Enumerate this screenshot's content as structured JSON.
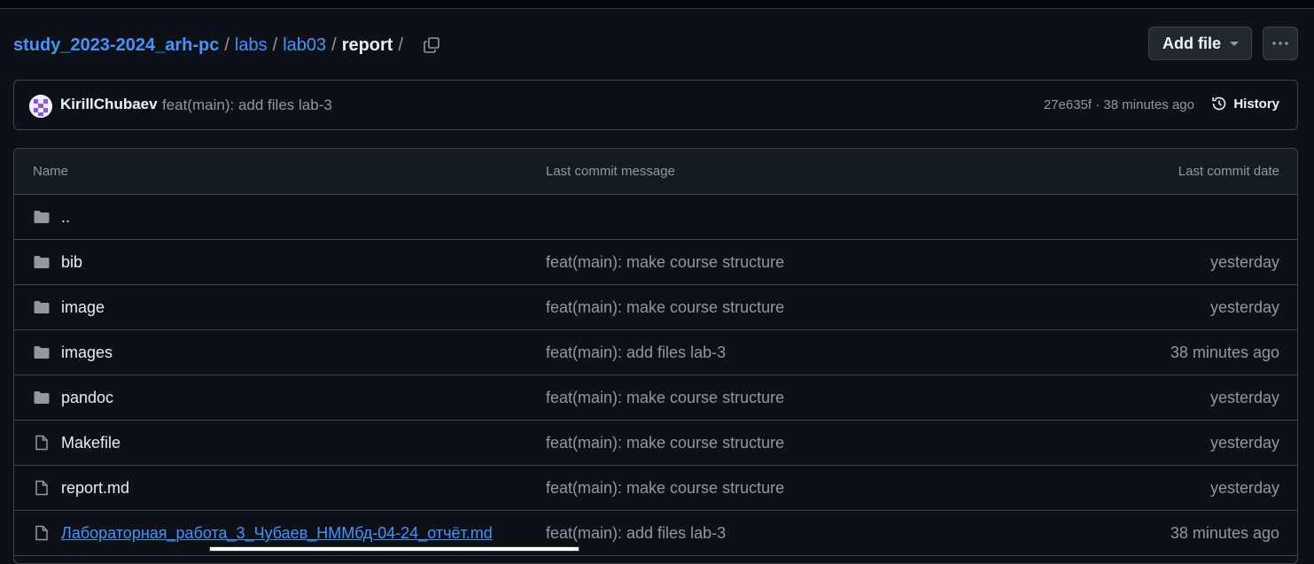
{
  "breadcrumb": {
    "repo": "study_2023-2024_arh-pc",
    "parts": [
      "labs",
      "lab03"
    ],
    "current": "report",
    "separator": "/"
  },
  "actions": {
    "add_file": "Add file"
  },
  "commit": {
    "author": "KirillChubaev",
    "message": "feat(main): add files lab-3",
    "hash_time": "27e635f · 38 minutes ago",
    "history_label": "History"
  },
  "table": {
    "headers": {
      "name": "Name",
      "message": "Last commit message",
      "date": "Last commit date"
    },
    "parent": "..",
    "rows": [
      {
        "name": "bib",
        "type": "folder",
        "message": "feat(main): make course structure",
        "date": "yesterday"
      },
      {
        "name": "image",
        "type": "folder",
        "message": "feat(main): make course structure",
        "date": "yesterday"
      },
      {
        "name": "images",
        "type": "folder",
        "message": "feat(main): add files lab-3",
        "date": "38 minutes ago"
      },
      {
        "name": "pandoc",
        "type": "folder",
        "message": "feat(main): make course structure",
        "date": "yesterday"
      },
      {
        "name": "Makefile",
        "type": "file",
        "message": "feat(main): make course structure",
        "date": "yesterday"
      },
      {
        "name": "report.md",
        "type": "file",
        "message": "feat(main): make course structure",
        "date": "yesterday"
      },
      {
        "name": "Лабораторная_работа_3_Чубаев_НММбд-04-24_отчёт.md",
        "type": "file",
        "message": "feat(main): add files lab-3",
        "date": "38 minutes ago"
      }
    ]
  },
  "colors": {
    "background": "#0d1117",
    "link": "#4493f8",
    "border": "#3d444d",
    "muted": "#9198a1"
  }
}
